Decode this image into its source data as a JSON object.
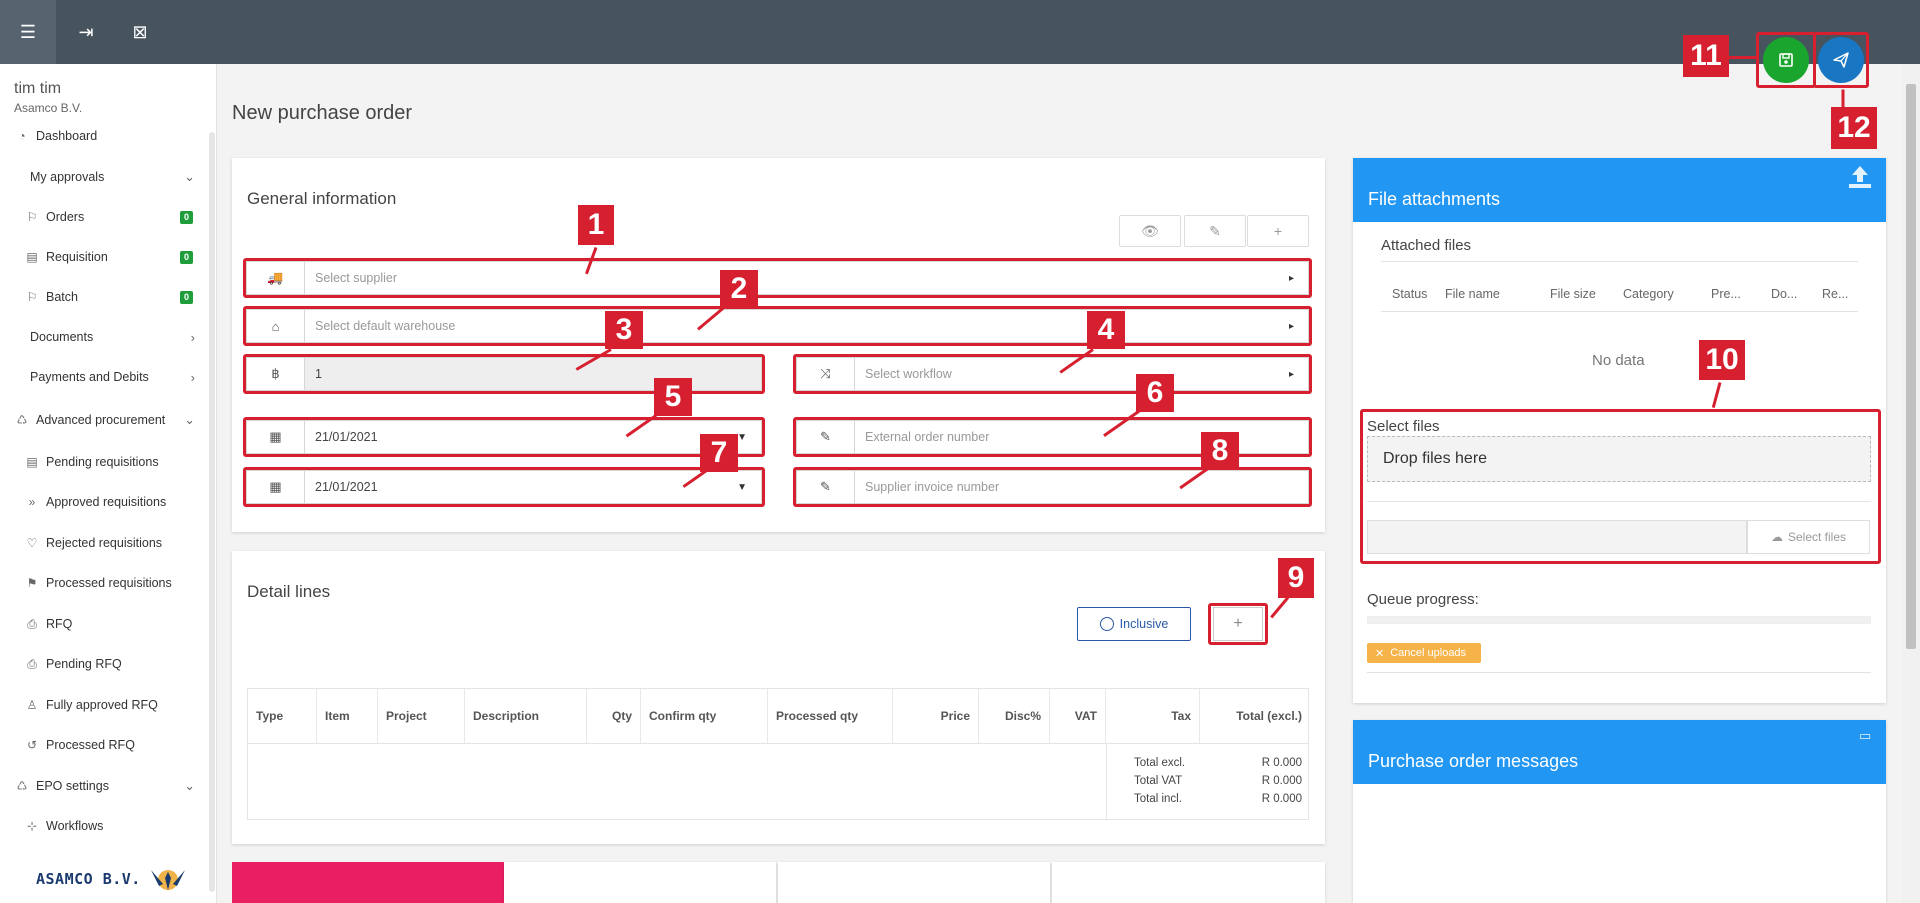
{
  "topbar": {
    "menu_icon": "hamburger-icon",
    "logout_icon": "logout-arrow-icon",
    "close_icon": "close-box-icon"
  },
  "user": {
    "name": "tim tim",
    "company": "Asamco B.V."
  },
  "sidebar": {
    "items": [
      {
        "label": "Dashboard",
        "icon": "dashboard-icon"
      },
      {
        "label": "My approvals",
        "chevron": "down"
      },
      {
        "label": "Orders",
        "icon": "flag-icon",
        "badge": "0"
      },
      {
        "label": "Requisition",
        "icon": "list-icon",
        "badge": "0"
      },
      {
        "label": "Batch",
        "icon": "flag-icon",
        "badge": "0"
      },
      {
        "label": "Documents",
        "chevron": "right"
      },
      {
        "label": "Payments and Debits",
        "chevron": "right"
      },
      {
        "label": "Advanced procurement",
        "icon": "recycle-icon",
        "chevron": "down"
      },
      {
        "label": "Pending requisitions",
        "icon": "list-icon"
      },
      {
        "label": "Approved requisitions",
        "icon": "fast-forward-icon"
      },
      {
        "label": "Rejected requisitions",
        "icon": "heart-broken-icon"
      },
      {
        "label": "Processed requisitions",
        "icon": "flag-checkered-icon"
      },
      {
        "label": "RFQ",
        "icon": "rfq-icon"
      },
      {
        "label": "Pending RFQ",
        "icon": "rfq-icon"
      },
      {
        "label": "Fully approved RFQ",
        "icon": "thumbs-up-icon"
      },
      {
        "label": "Processed RFQ",
        "icon": "history-icon"
      },
      {
        "label": "EPO settings",
        "icon": "recycle-icon",
        "chevron": "down"
      },
      {
        "label": "Workflows",
        "icon": "sitemap-icon"
      }
    ],
    "logo_text": "ASAMCO B.V."
  },
  "page": {
    "title": "New purchase order"
  },
  "general": {
    "title": "General information",
    "supplier_placeholder": "Select supplier",
    "warehouse_placeholder": "Select default warehouse",
    "currency_value": "1",
    "currency_symbol": "฿",
    "workflow_placeholder": "Select workflow",
    "order_date": "21/01/2021",
    "delivery_date": "21/01/2021",
    "external_order_placeholder": "External order number",
    "supplier_invoice_placeholder": "Supplier invoice number"
  },
  "detail": {
    "title": "Detail lines",
    "inclusive_label": "Inclusive",
    "columns": [
      "Type",
      "Item",
      "Project",
      "Description",
      "Qty",
      "Confirm qty",
      "Processed qty",
      "Price",
      "Disc%",
      "VAT",
      "Tax",
      "Total (excl.)"
    ],
    "totals": [
      {
        "label": "Total excl.",
        "value": "R 0.000"
      },
      {
        "label": "Total VAT",
        "value": "R 0.000"
      },
      {
        "label": "Total incl.",
        "value": "R 0.000"
      }
    ]
  },
  "attachments": {
    "title": "File attachments",
    "attached_title": "Attached files",
    "columns": [
      "Status",
      "File name",
      "File size",
      "Category",
      "Pre...",
      "Do...",
      "Re..."
    ],
    "no_data": "No data",
    "select_files_label": "Select files",
    "drop_text": "Drop files here",
    "select_files_button": "Select files",
    "queue_label": "Queue progress:",
    "queue_progress": 0,
    "cancel_uploads": "Cancel uploads"
  },
  "messages": {
    "title": "Purchase order messages"
  },
  "annotations": [
    "1",
    "2",
    "3",
    "4",
    "5",
    "6",
    "7",
    "8",
    "9",
    "10",
    "11",
    "12"
  ],
  "colors": {
    "topbar": "#47535d",
    "accent_blue": "#2196f3",
    "save_green": "#1aa52f",
    "send_blue": "#1976c2",
    "annotation_red": "#d6202f",
    "badge_green": "#1f9d3a",
    "tile_pink": "#e91e63"
  }
}
